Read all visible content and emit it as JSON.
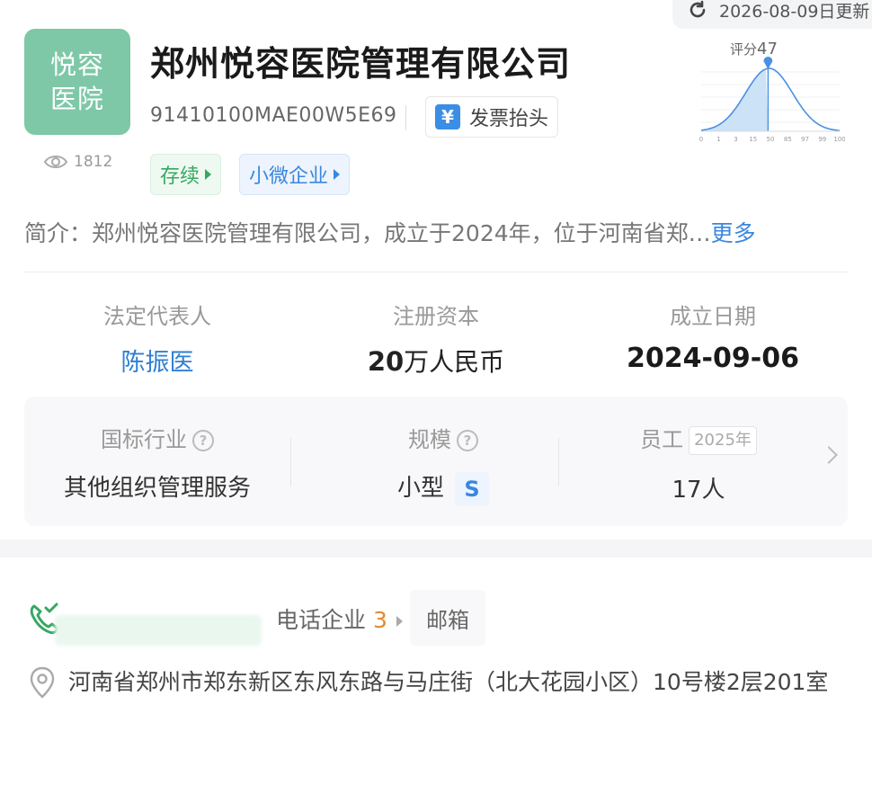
{
  "header": {
    "update_text": "2026-08-09日更新",
    "logo_line1": "悦容",
    "logo_line2": "医院",
    "views": "1812",
    "company_name": "郑州悦容医院管理有限公司",
    "credit_code": "91410100MAE00W5E69",
    "invoice_label": "发票抬头",
    "invoice_icon_text": "¥",
    "tags": {
      "status": "存续",
      "type": "小微企业"
    }
  },
  "score": {
    "label": "评分",
    "value": "47",
    "scale": [
      "0",
      "1",
      "3",
      "15",
      "50",
      "85",
      "97",
      "99",
      "100"
    ],
    "marker_position_fraction": 0.47,
    "fill_color": "#c6dff5",
    "line_color": "#4a90e2"
  },
  "intro": {
    "text": "简介：郑州悦容医院管理有限公司，成立于2024年，位于河南省郑…",
    "more": "更多"
  },
  "key_info": {
    "legal_rep_label": "法定代表人",
    "legal_rep": "陈振医",
    "capital_label": "注册资本",
    "capital_num": "20",
    "capital_unit": "万人民币",
    "founded_label": "成立日期",
    "founded": "2024-09-06"
  },
  "industry_card": {
    "industry_label": "国标行业",
    "industry": "其他组织管理服务",
    "scale_label": "规模",
    "scale": "小型",
    "scale_badge": "S",
    "staff_label": "员工",
    "staff_year": "2025年",
    "staff": "17人",
    "help_icon_text": "?"
  },
  "contact": {
    "phone_text": "电话企业",
    "same_phone_count": "3",
    "email_label": "邮箱",
    "address": "河南省郑州市郑东新区东风东路与马庄街（北大花园小区）10号楼2层201室"
  },
  "colors": {
    "accent": "#3a87e0",
    "green": "#36a862",
    "orange": "#e58a2c",
    "logo_bg": "#7ec8a7"
  }
}
